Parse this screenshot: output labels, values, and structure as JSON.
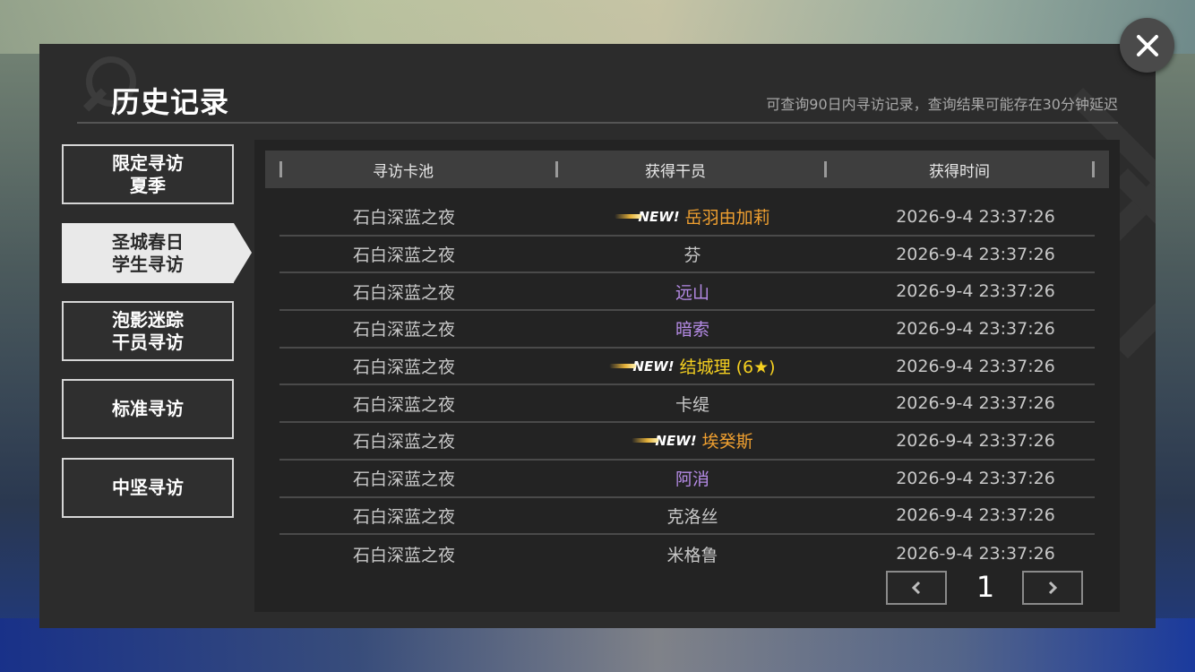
{
  "dialog": {
    "title": "历史记录",
    "subtitle": "可查询90日内寻访记录，查询结果可能存在30分钟延迟"
  },
  "tabs": [
    {
      "label": "限定寻访\n夏季",
      "active": false
    },
    {
      "label": "圣城春日\n学生寻访",
      "active": true
    },
    {
      "label": "泡影迷踪\n干员寻访",
      "active": false
    },
    {
      "label": "标准寻访",
      "active": false
    },
    {
      "label": "中坚寻访",
      "active": false
    }
  ],
  "table": {
    "headers": {
      "pool": "寻访卡池",
      "operator": "获得干员",
      "time": "获得时间"
    },
    "new_label": "NEW!",
    "rows": [
      {
        "pool": "石白深蓝之夜",
        "operator": "岳羽由加莉",
        "is_new": true,
        "color": "#f0a030",
        "time": "2026-9-4 23:37:26"
      },
      {
        "pool": "石白深蓝之夜",
        "operator": "芬",
        "is_new": false,
        "color": "#c8c8c8",
        "time": "2026-9-4 23:37:26"
      },
      {
        "pool": "石白深蓝之夜",
        "operator": "远山",
        "is_new": false,
        "color": "#b58be6",
        "time": "2026-9-4 23:37:26"
      },
      {
        "pool": "石白深蓝之夜",
        "operator": "暗索",
        "is_new": false,
        "color": "#b58be6",
        "time": "2026-9-4 23:37:26"
      },
      {
        "pool": "石白深蓝之夜",
        "operator": "结城理 (6★)",
        "is_new": true,
        "color": "#f5d020",
        "time": "2026-9-4 23:37:26"
      },
      {
        "pool": "石白深蓝之夜",
        "operator": "卡缇",
        "is_new": false,
        "color": "#c8c8c8",
        "time": "2026-9-4 23:37:26"
      },
      {
        "pool": "石白深蓝之夜",
        "operator": "埃癸斯",
        "is_new": true,
        "color": "#f0a030",
        "time": "2026-9-4 23:37:26"
      },
      {
        "pool": "石白深蓝之夜",
        "operator": "阿消",
        "is_new": false,
        "color": "#b58be6",
        "time": "2026-9-4 23:37:26"
      },
      {
        "pool": "石白深蓝之夜",
        "operator": "克洛丝",
        "is_new": false,
        "color": "#c8c8c8",
        "time": "2026-9-4 23:37:26"
      },
      {
        "pool": "石白深蓝之夜",
        "operator": "米格鲁",
        "is_new": false,
        "color": "#c8c8c8",
        "time": "2026-9-4 23:37:26"
      }
    ]
  },
  "pagination": {
    "current_page": "1"
  },
  "icons": {
    "close": "close-icon",
    "prev": "chevron-left-icon",
    "next": "chevron-right-icon"
  }
}
